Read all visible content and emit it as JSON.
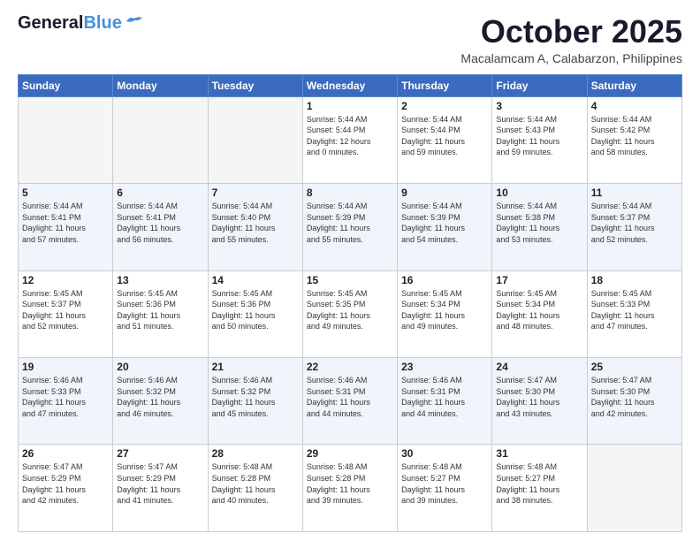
{
  "header": {
    "logo_line1": "General",
    "logo_line2": "Blue",
    "month": "October 2025",
    "location": "Macalamcam A, Calabarzon, Philippines"
  },
  "days_of_week": [
    "Sunday",
    "Monday",
    "Tuesday",
    "Wednesday",
    "Thursday",
    "Friday",
    "Saturday"
  ],
  "weeks": [
    {
      "days": [
        {
          "num": "",
          "info": ""
        },
        {
          "num": "",
          "info": ""
        },
        {
          "num": "",
          "info": ""
        },
        {
          "num": "1",
          "info": "Sunrise: 5:44 AM\nSunset: 5:44 PM\nDaylight: 12 hours\nand 0 minutes."
        },
        {
          "num": "2",
          "info": "Sunrise: 5:44 AM\nSunset: 5:44 PM\nDaylight: 11 hours\nand 59 minutes."
        },
        {
          "num": "3",
          "info": "Sunrise: 5:44 AM\nSunset: 5:43 PM\nDaylight: 11 hours\nand 59 minutes."
        },
        {
          "num": "4",
          "info": "Sunrise: 5:44 AM\nSunset: 5:42 PM\nDaylight: 11 hours\nand 58 minutes."
        }
      ]
    },
    {
      "days": [
        {
          "num": "5",
          "info": "Sunrise: 5:44 AM\nSunset: 5:41 PM\nDaylight: 11 hours\nand 57 minutes."
        },
        {
          "num": "6",
          "info": "Sunrise: 5:44 AM\nSunset: 5:41 PM\nDaylight: 11 hours\nand 56 minutes."
        },
        {
          "num": "7",
          "info": "Sunrise: 5:44 AM\nSunset: 5:40 PM\nDaylight: 11 hours\nand 55 minutes."
        },
        {
          "num": "8",
          "info": "Sunrise: 5:44 AM\nSunset: 5:39 PM\nDaylight: 11 hours\nand 55 minutes."
        },
        {
          "num": "9",
          "info": "Sunrise: 5:44 AM\nSunset: 5:39 PM\nDaylight: 11 hours\nand 54 minutes."
        },
        {
          "num": "10",
          "info": "Sunrise: 5:44 AM\nSunset: 5:38 PM\nDaylight: 11 hours\nand 53 minutes."
        },
        {
          "num": "11",
          "info": "Sunrise: 5:44 AM\nSunset: 5:37 PM\nDaylight: 11 hours\nand 52 minutes."
        }
      ]
    },
    {
      "days": [
        {
          "num": "12",
          "info": "Sunrise: 5:45 AM\nSunset: 5:37 PM\nDaylight: 11 hours\nand 52 minutes."
        },
        {
          "num": "13",
          "info": "Sunrise: 5:45 AM\nSunset: 5:36 PM\nDaylight: 11 hours\nand 51 minutes."
        },
        {
          "num": "14",
          "info": "Sunrise: 5:45 AM\nSunset: 5:36 PM\nDaylight: 11 hours\nand 50 minutes."
        },
        {
          "num": "15",
          "info": "Sunrise: 5:45 AM\nSunset: 5:35 PM\nDaylight: 11 hours\nand 49 minutes."
        },
        {
          "num": "16",
          "info": "Sunrise: 5:45 AM\nSunset: 5:34 PM\nDaylight: 11 hours\nand 49 minutes."
        },
        {
          "num": "17",
          "info": "Sunrise: 5:45 AM\nSunset: 5:34 PM\nDaylight: 11 hours\nand 48 minutes."
        },
        {
          "num": "18",
          "info": "Sunrise: 5:45 AM\nSunset: 5:33 PM\nDaylight: 11 hours\nand 47 minutes."
        }
      ]
    },
    {
      "days": [
        {
          "num": "19",
          "info": "Sunrise: 5:46 AM\nSunset: 5:33 PM\nDaylight: 11 hours\nand 47 minutes."
        },
        {
          "num": "20",
          "info": "Sunrise: 5:46 AM\nSunset: 5:32 PM\nDaylight: 11 hours\nand 46 minutes."
        },
        {
          "num": "21",
          "info": "Sunrise: 5:46 AM\nSunset: 5:32 PM\nDaylight: 11 hours\nand 45 minutes."
        },
        {
          "num": "22",
          "info": "Sunrise: 5:46 AM\nSunset: 5:31 PM\nDaylight: 11 hours\nand 44 minutes."
        },
        {
          "num": "23",
          "info": "Sunrise: 5:46 AM\nSunset: 5:31 PM\nDaylight: 11 hours\nand 44 minutes."
        },
        {
          "num": "24",
          "info": "Sunrise: 5:47 AM\nSunset: 5:30 PM\nDaylight: 11 hours\nand 43 minutes."
        },
        {
          "num": "25",
          "info": "Sunrise: 5:47 AM\nSunset: 5:30 PM\nDaylight: 11 hours\nand 42 minutes."
        }
      ]
    },
    {
      "days": [
        {
          "num": "26",
          "info": "Sunrise: 5:47 AM\nSunset: 5:29 PM\nDaylight: 11 hours\nand 42 minutes."
        },
        {
          "num": "27",
          "info": "Sunrise: 5:47 AM\nSunset: 5:29 PM\nDaylight: 11 hours\nand 41 minutes."
        },
        {
          "num": "28",
          "info": "Sunrise: 5:48 AM\nSunset: 5:28 PM\nDaylight: 11 hours\nand 40 minutes."
        },
        {
          "num": "29",
          "info": "Sunrise: 5:48 AM\nSunset: 5:28 PM\nDaylight: 11 hours\nand 39 minutes."
        },
        {
          "num": "30",
          "info": "Sunrise: 5:48 AM\nSunset: 5:27 PM\nDaylight: 11 hours\nand 39 minutes."
        },
        {
          "num": "31",
          "info": "Sunrise: 5:48 AM\nSunset: 5:27 PM\nDaylight: 11 hours\nand 38 minutes."
        },
        {
          "num": "",
          "info": ""
        }
      ]
    }
  ]
}
